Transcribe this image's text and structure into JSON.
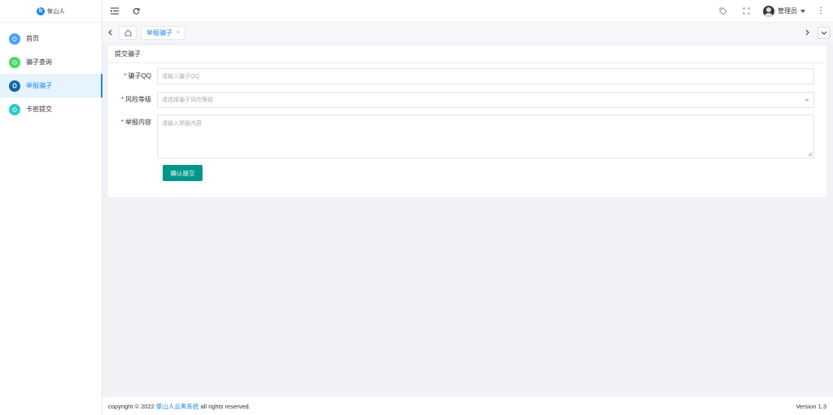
{
  "logo": {
    "mark": "b",
    "text": "傢山人"
  },
  "sidebar": {
    "items": [
      {
        "label": "首页",
        "icon": "home-icon",
        "color": "#4aa3f5",
        "active": false
      },
      {
        "label": "骗子查询",
        "icon": "search-icon",
        "color": "#4cd964",
        "active": false
      },
      {
        "label": "举报骗子",
        "icon": "report-icon",
        "color": "#1565a8",
        "active": true
      },
      {
        "label": "卡密提交",
        "icon": "card-icon",
        "color": "#2ec8c8",
        "active": false
      }
    ]
  },
  "header": {
    "user_name": "管理员"
  },
  "tabs": {
    "active_label": "举报骗子",
    "close": "×"
  },
  "form": {
    "title": "提交骗子",
    "qq_label": "骗子QQ",
    "qq_placeholder": "请输入骗子QQ",
    "risk_label": "风险等级",
    "risk_placeholder": "请选择骗子风险等级",
    "content_label": "举报内容",
    "content_placeholder": "请输入举报内容",
    "required_mark": "*",
    "submit_label": "确认提交"
  },
  "footer": {
    "prefix": "copyright © 2022 ",
    "link_text": "傢山人云黑系统",
    "suffix": " all rights reserved.",
    "version": "Version 1.3"
  },
  "colors": {
    "accent": "#1e88e5",
    "submit": "#009688",
    "required": "#f5222d"
  }
}
